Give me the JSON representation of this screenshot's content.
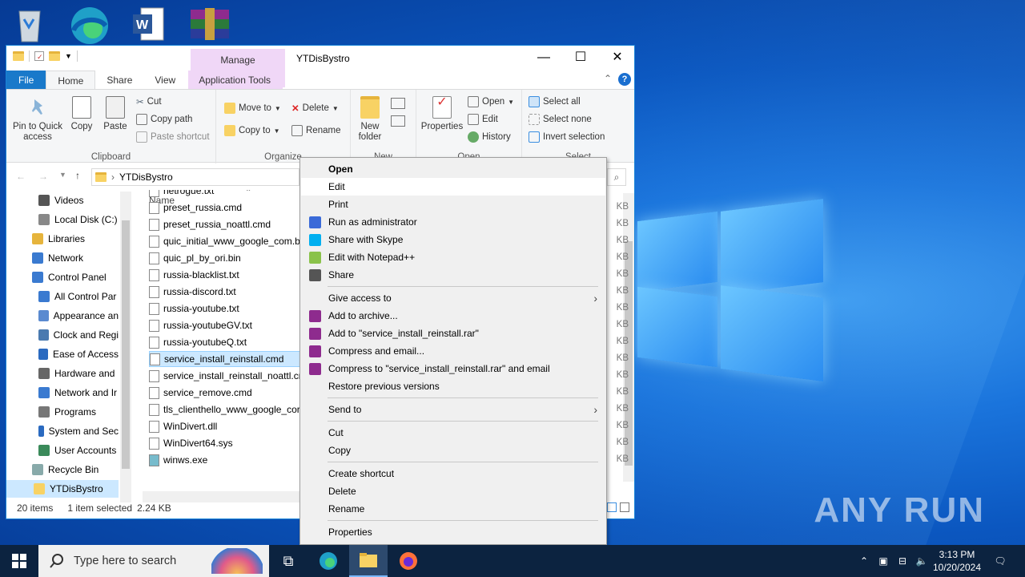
{
  "desktop": {
    "icons": [
      "recycle-bin-icon",
      "edge-icon",
      "word-icon",
      "winrar-icon"
    ],
    "watermark": "ANY RUN"
  },
  "explorer": {
    "title": "YTDisBystro",
    "manage_tab": "Manage",
    "tabs": [
      "File",
      "Home",
      "Share",
      "View",
      "Application Tools"
    ],
    "ribbon": {
      "clipboard": {
        "label": "Clipboard",
        "pin": "Pin to Quick access",
        "copy": "Copy",
        "paste": "Paste",
        "cut": "Cut",
        "copy_path": "Copy path",
        "paste_shortcut": "Paste shortcut"
      },
      "organize": {
        "label": "Organize",
        "move_to": "Move to",
        "copy_to": "Copy to",
        "delete": "Delete",
        "rename": "Rename"
      },
      "new": {
        "label": "New",
        "new_folder": "New folder"
      },
      "open": {
        "label": "Open",
        "properties": "Properties",
        "open": "Open",
        "edit": "Edit",
        "history": "History"
      },
      "select": {
        "label": "Select",
        "select_all": "Select all",
        "select_none": "Select none",
        "invert": "Invert selection"
      }
    },
    "address": {
      "path": "YTDisBystro"
    },
    "nav_items": [
      {
        "label": "Videos",
        "indent": 1
      },
      {
        "label": "Local Disk (C:)",
        "indent": 1
      },
      {
        "label": "Libraries",
        "indent": 0
      },
      {
        "label": "Network",
        "indent": 0
      },
      {
        "label": "Control Panel",
        "indent": 0
      },
      {
        "label": "All Control Par",
        "indent": 1
      },
      {
        "label": "Appearance an",
        "indent": 1
      },
      {
        "label": "Clock and Regi",
        "indent": 1
      },
      {
        "label": "Ease of Access",
        "indent": 1
      },
      {
        "label": "Hardware and",
        "indent": 1
      },
      {
        "label": "Network and Ir",
        "indent": 1
      },
      {
        "label": "Programs",
        "indent": 1
      },
      {
        "label": "System and Sec",
        "indent": 1
      },
      {
        "label": "User Accounts",
        "indent": 1
      },
      {
        "label": "Recycle Bin",
        "indent": 0
      },
      {
        "label": "YTDisBystro",
        "indent": 0
      }
    ],
    "column_name": "Name",
    "files": [
      "netrogue.txt",
      "preset_russia.cmd",
      "preset_russia_noattl.cmd",
      "quic_initial_www_google_com.b",
      "quic_pl_by_ori.bin",
      "russia-blacklist.txt",
      "russia-discord.txt",
      "russia-youtube.txt",
      "russia-youtubeGV.txt",
      "russia-youtubeQ.txt",
      "service_install_reinstall.cmd",
      "service_install_reinstall_noattl.cr",
      "service_remove.cmd",
      "tls_clienthello_www_google_cor",
      "WinDivert.dll",
      "WinDivert64.sys",
      "winws.exe"
    ],
    "selected_file_index": 10,
    "size_suffix": "KB",
    "status": {
      "items": "20 items",
      "selected": "1 item selected",
      "size": "2.24 KB"
    }
  },
  "context_menu": {
    "items": [
      {
        "label": "Open",
        "bold": true
      },
      {
        "label": "Edit",
        "highlight": true
      },
      {
        "label": "Print"
      },
      {
        "label": "Run as administrator",
        "icon": "shield-icon"
      },
      {
        "label": "Share with Skype",
        "icon": "skype-icon"
      },
      {
        "label": "Edit with Notepad++",
        "icon": "notepadpp-icon"
      },
      {
        "label": "Share",
        "icon": "share-icon"
      },
      {
        "sep": true
      },
      {
        "label": "Give access to",
        "submenu": true
      },
      {
        "label": "Add to archive...",
        "icon": "winrar-icon"
      },
      {
        "label": "Add to \"service_install_reinstall.rar\"",
        "icon": "winrar-icon"
      },
      {
        "label": "Compress and email...",
        "icon": "winrar-icon"
      },
      {
        "label": "Compress to \"service_install_reinstall.rar\" and email",
        "icon": "winrar-icon"
      },
      {
        "label": "Restore previous versions"
      },
      {
        "sep": true
      },
      {
        "label": "Send to",
        "submenu": true
      },
      {
        "sep": true
      },
      {
        "label": "Cut"
      },
      {
        "label": "Copy"
      },
      {
        "sep": true
      },
      {
        "label": "Create shortcut"
      },
      {
        "label": "Delete"
      },
      {
        "label": "Rename"
      },
      {
        "sep": true
      },
      {
        "label": "Properties"
      }
    ]
  },
  "taskbar": {
    "search_placeholder": "Type here to search",
    "time": "3:13 PM",
    "date": "10/20/2024"
  }
}
